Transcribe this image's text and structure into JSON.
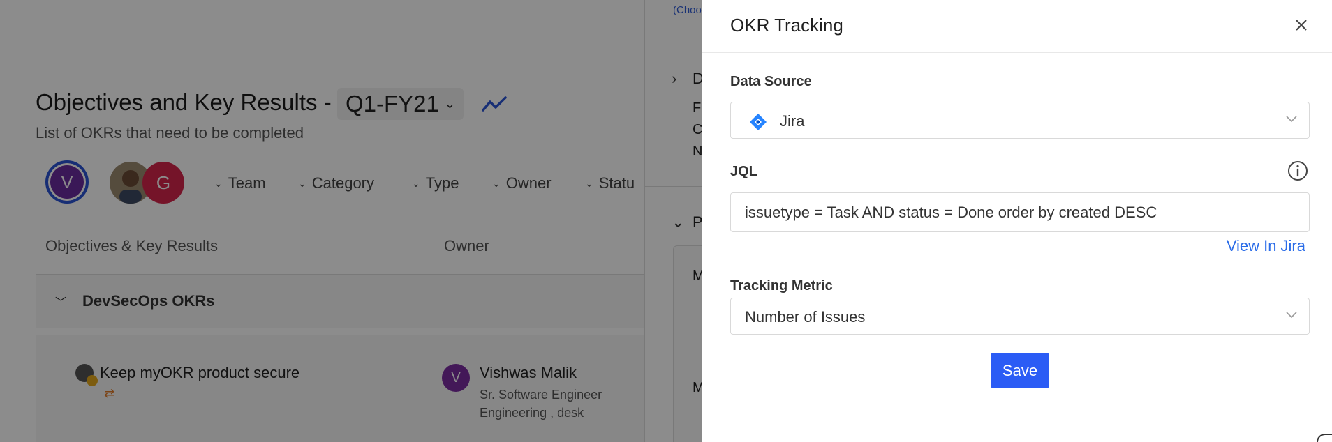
{
  "background": {
    "page_title": "Objectives and Key Results -",
    "quarter": "Q1-FY21",
    "subtitle": "List of OKRs that need to be completed",
    "avatars": [
      "V",
      "G"
    ],
    "filters": [
      "Team",
      "Category",
      "Type",
      "Owner",
      "Statu"
    ],
    "table_headers": [
      "Objectives & Key Results",
      "Owner"
    ],
    "group": "DevSecOps OKRs",
    "objective": {
      "title": "Keep myOKR product secure",
      "owner_initial": "V",
      "owner_name": "Vishwas Malik",
      "owner_role": "Sr. Software Engineer",
      "owner_dept": "Engineering , desk"
    },
    "mid_panel": {
      "choose_text": "(Choo",
      "letters": [
        "D",
        "F",
        "C",
        "N",
        "P",
        "M",
        "M"
      ]
    }
  },
  "modal": {
    "title": "OKR Tracking",
    "data_source": {
      "label": "Data Source",
      "value": "Jira"
    },
    "jql": {
      "label": "JQL",
      "value": "issuetype = Task AND status = Done order by created DESC",
      "link": "View In Jira"
    },
    "tracking_metric": {
      "label": "Tracking Metric",
      "value": "Number of Issues"
    },
    "save_label": "Save"
  },
  "colors": {
    "primary": "#2b5cf5",
    "link": "#2a6ce8",
    "jira_blue": "#2684ff"
  }
}
